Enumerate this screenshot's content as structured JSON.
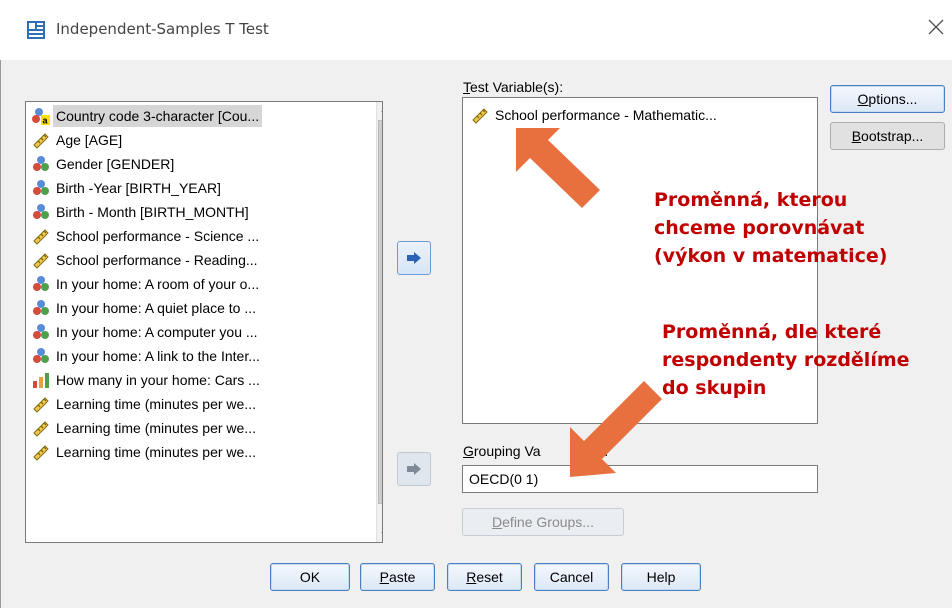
{
  "window": {
    "title": "Independent-Samples T Test",
    "close_icon": "close-icon"
  },
  "source_list": {
    "items": [
      {
        "label": "Country code 3-character [Cou...",
        "icon": "nominal-string-icon",
        "selected": true
      },
      {
        "label": "Age [AGE]",
        "icon": "scale-ruler-icon"
      },
      {
        "label": "Gender [GENDER]",
        "icon": "nominal-icon"
      },
      {
        "label": "Birth -Year [BIRTH_YEAR]",
        "icon": "nominal-icon"
      },
      {
        "label": "Birth - Month [BIRTH_MONTH]",
        "icon": "nominal-icon"
      },
      {
        "label": "School performance - Science ...",
        "icon": "scale-ruler-icon"
      },
      {
        "label": "School performance - Reading...",
        "icon": "scale-ruler-icon"
      },
      {
        "label": "In your home: A room of your o...",
        "icon": "nominal-icon"
      },
      {
        "label": "In your home: A quiet place to ...",
        "icon": "nominal-icon"
      },
      {
        "label": "In your home: A computer you ...",
        "icon": "nominal-icon"
      },
      {
        "label": "In your home: A link to the Inter...",
        "icon": "nominal-icon"
      },
      {
        "label": "How many in your home: Cars ...",
        "icon": "ordinal-bar-icon"
      },
      {
        "label": "Learning time (minutes per we...",
        "icon": "scale-ruler-icon"
      },
      {
        "label": "Learning time (minutes per we...",
        "icon": "scale-ruler-icon"
      },
      {
        "label": "Learning time (minutes per we...",
        "icon": "scale-ruler-icon"
      }
    ]
  },
  "test_variables": {
    "label_u": "T",
    "label_rest": "est Variable(s):",
    "items": [
      {
        "label": "School performance - Mathematic...",
        "icon": "scale-ruler-icon"
      }
    ]
  },
  "grouping": {
    "label_u": "G",
    "label_rest": "rouping Va",
    "label_tail": "e:",
    "value": "OECD(0 1)",
    "define_u": "D",
    "define_rest": "efine Groups..."
  },
  "side_buttons": {
    "options_u": "O",
    "options_rest": "ptions...",
    "bootstrap_u": "B",
    "bootstrap_rest": "ootstrap..."
  },
  "bottom_buttons": {
    "ok": "OK",
    "paste_u": "P",
    "paste_rest": "aste",
    "reset_u": "R",
    "reset_rest": "eset",
    "cancel": "Cancel",
    "help": "Help"
  },
  "annotations": {
    "test_var_lines": [
      "Proměnná, kterou",
      "chceme porovnávat",
      "(výkon v matematice)"
    ],
    "grouping_lines": [
      "Proměnná, dle které",
      "respondenty rozdělíme",
      "do skupin"
    ],
    "arrow_color": "#e8703f",
    "text_color": "#c00000"
  },
  "colors": {
    "accent": "#4a7fc4",
    "dialog_bg": "#f0f0f0"
  }
}
